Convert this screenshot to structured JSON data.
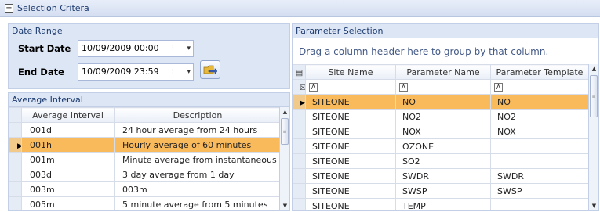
{
  "header": {
    "title": "Selection Critera",
    "toggle_icon": "minus-icon"
  },
  "date_range": {
    "label": "Date Range",
    "start_label": "Start Date",
    "start_value": "10/09/2009 00:00",
    "end_label": "End Date",
    "end_value": "10/09/2009 23:59",
    "go_icon": "folder-arrow-icon"
  },
  "average_interval": {
    "label": "Average Interval",
    "columns": [
      "Average Interval",
      "Description"
    ],
    "rows": [
      {
        "interval": "001d",
        "description": "24 hour average from 24 hours"
      },
      {
        "interval": "001h",
        "description": "Hourly average of 60 minutes"
      },
      {
        "interval": "001m",
        "description": "Minute average from instantaneous"
      },
      {
        "interval": "003d",
        "description": "3 day average from 1 day"
      },
      {
        "interval": "003m",
        "description": "003m"
      },
      {
        "interval": "005m",
        "description": "5 minute average from 5 minutes"
      }
    ],
    "selected_index": 1
  },
  "parameter_selection": {
    "label": "Parameter Selection",
    "group_panel_text": "Drag a column header here to group by that column.",
    "columns": [
      "Site Name",
      "Parameter Name",
      "Parameter Template"
    ],
    "rows": [
      {
        "site": "SITEONE",
        "param": "NO",
        "template": "NO"
      },
      {
        "site": "SITEONE",
        "param": "NO2",
        "template": "NO2"
      },
      {
        "site": "SITEONE",
        "param": "NOX",
        "template": "NOX"
      },
      {
        "site": "SITEONE",
        "param": "OZONE",
        "template": ""
      },
      {
        "site": "SITEONE",
        "param": "SO2",
        "template": ""
      },
      {
        "site": "SITEONE",
        "param": "SWDR",
        "template": "SWDR"
      },
      {
        "site": "SITEONE",
        "param": "SWSP",
        "template": "SWSP"
      },
      {
        "site": "SITEONE",
        "param": "TEMP",
        "template": ""
      }
    ],
    "selected_index": 0
  },
  "colors": {
    "accent": "#f9ba5c",
    "panel": "#dde6f5",
    "border": "#c3cfe6"
  }
}
